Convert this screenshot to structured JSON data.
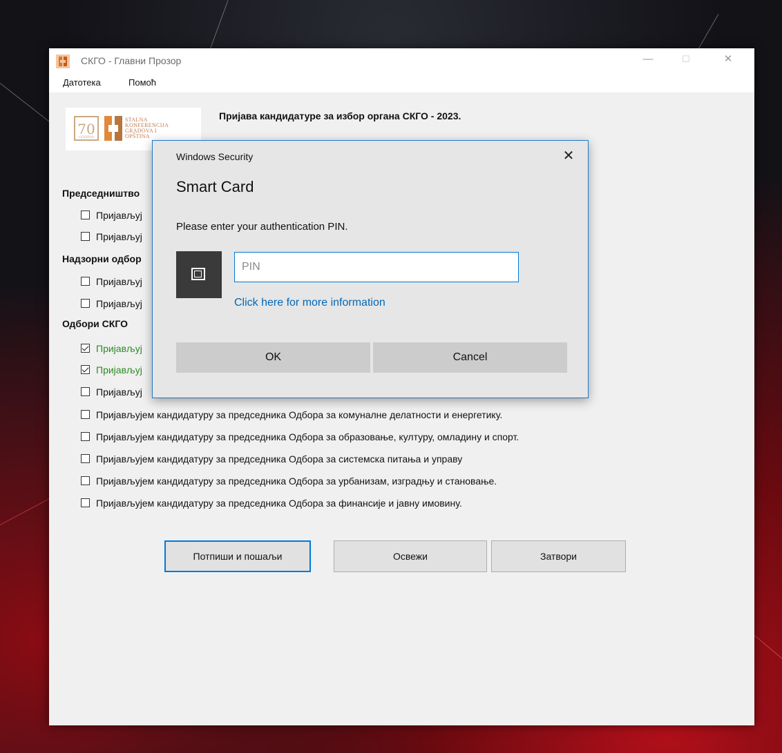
{
  "window": {
    "title": "СКГО - Главни Прозор",
    "controls": {
      "minimize": "—",
      "maximize": "☐",
      "close": "✕"
    }
  },
  "menu": [
    "Датотека",
    "Помоћ"
  ],
  "logo": {
    "badge": "70",
    "badge_sub": "GODINA",
    "lines": [
      "STALNA",
      "KONFERENCIJA",
      "GRADOVA I",
      "OPŠTINA"
    ]
  },
  "form_title": "Пријава кандидатуре за избор органа СКГО - 2023.",
  "sections": {
    "presidency": {
      "title": "Председништво",
      "items": [
        {
          "label": "Пријављуј",
          "checked": false
        },
        {
          "label": "Пријављуј",
          "checked": false
        }
      ]
    },
    "supervisory": {
      "title": "Надзорни одбор",
      "items": [
        {
          "label": "Пријављуј",
          "checked": false
        },
        {
          "label": "Пријављуј",
          "checked": false
        }
      ]
    },
    "committees": {
      "title": "Одбори СКГО",
      "items": [
        {
          "label": "Пријављуј",
          "checked": true
        },
        {
          "label": "Пријављуј",
          "checked": true
        },
        {
          "label": "Пријављуј",
          "checked": false
        },
        {
          "label": "Пријављујем кандидатуру за председника Одбора за комуналне делатности и енергетику.",
          "checked": false
        },
        {
          "label": "Пријављујем кандидатуру за председника Одбора за образовање, културу, омладину и спорт.",
          "checked": false
        },
        {
          "label": "Пријављујем кандидатуру за председника Одбора за системска питања и управу",
          "checked": false
        },
        {
          "label": "Пријављујем кандидатуру за председника Одбора за урбанизам, изградњу и становање.",
          "checked": false
        },
        {
          "label": "Пријављујем кандидатуру за председника Одбора за финансије и јавну имовину.",
          "checked": false
        }
      ]
    }
  },
  "buttons": {
    "sign_send": "Потпиши и пошаљи",
    "refresh": "Освежи",
    "close": "Затвори"
  },
  "dialog": {
    "caption": "Windows Security",
    "close_glyph": "✕",
    "title": "Smart Card",
    "message": "Please enter your authentication PIN.",
    "pin_placeholder": "PIN",
    "pin_value": "",
    "info_link": "Click here for more information",
    "ok": "OK",
    "cancel": "Cancel"
  }
}
